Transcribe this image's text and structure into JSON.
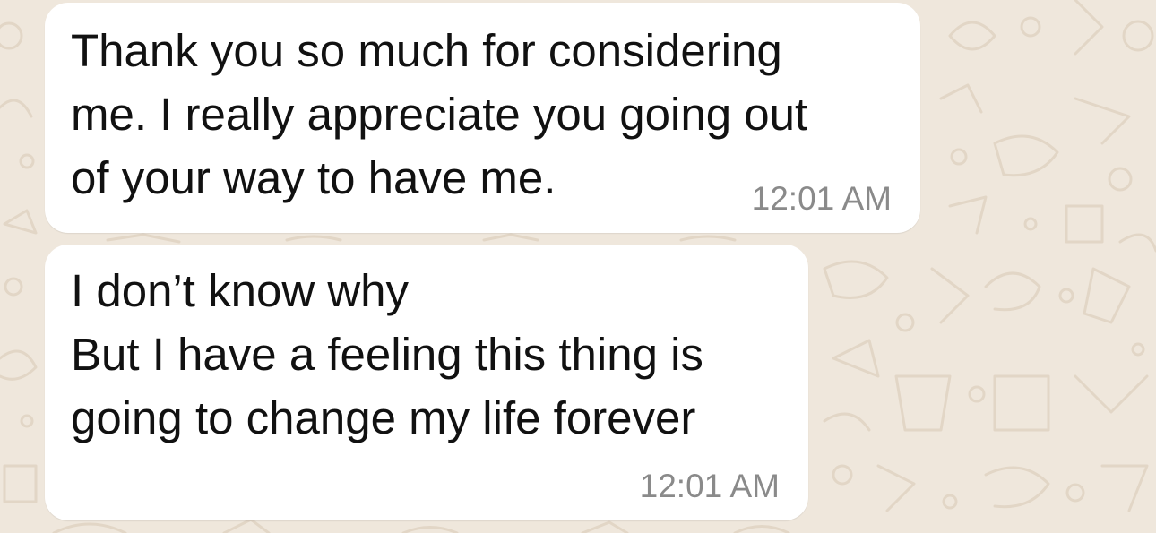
{
  "conversation": {
    "messages": [
      {
        "text": "Thank you so much for considering\nme. I really appreciate you going out\nof your way to have me.",
        "time": "12:01 AM"
      },
      {
        "text": "I don’t know why\nBut I have a feeling this thing is\ngoing to change my life forever",
        "time": "12:01 AM"
      }
    ]
  },
  "theme": {
    "background": "#efe7dc",
    "doodle_color": "#e2d6c6",
    "bubble_color": "#ffffff",
    "text_color": "#111111",
    "time_color": "#8a8a8a"
  }
}
